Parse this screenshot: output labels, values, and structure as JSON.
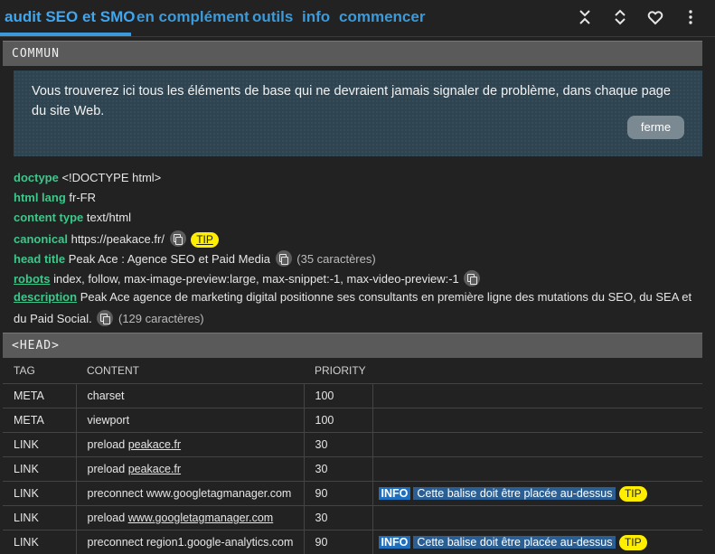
{
  "tabs": [
    "audit SEO et SMO",
    "en complément",
    "outils",
    "info",
    "commencer"
  ],
  "toolbar_icons": [
    "collapse-all-icon",
    "expand-all-icon",
    "heart-icon",
    "more-vertical-icon"
  ],
  "sections": {
    "commun": "COMMUN",
    "head": "<HEAD>"
  },
  "notice": {
    "text": "Vous trouverez ici tous les éléments de base qui ne devraient jamais signaler de problème, dans chaque page du site Web.",
    "close_label": "ferme"
  },
  "meta": {
    "doctype": {
      "key": "doctype",
      "value": "<!DOCTYPE html>"
    },
    "html_lang": {
      "key": "html lang",
      "value": "fr-FR"
    },
    "content_type": {
      "key": "content type",
      "value": "text/html"
    },
    "canonical": {
      "key": "canonical",
      "value": "https://peakace.fr/",
      "tip": "TIP"
    },
    "head_title": {
      "key": "head title",
      "value": "Peak Ace : Agence SEO et Paid Media",
      "count": "(35 caractères)"
    },
    "robots": {
      "key": "robots",
      "value": "index, follow, max-image-preview:large, max-snippet:-1, max-video-preview:-1"
    },
    "description": {
      "key": "description",
      "value_line1": "Peak Ace agence de marketing digital positionne ses consultants en première ligne des mutations du SEO, du SEA et",
      "value_line2": "du Paid Social.",
      "count": "(129 caractères)"
    }
  },
  "head_table": {
    "columns": [
      "TAG",
      "CONTENT",
      "PRIORITY"
    ],
    "rows": [
      {
        "tag": "META",
        "content": "charset",
        "priority": "100"
      },
      {
        "tag": "META",
        "content": "viewport",
        "priority": "100"
      },
      {
        "tag": "LINK",
        "content_prefix": "preload",
        "content_link": "peakace.fr",
        "priority": "30"
      },
      {
        "tag": "LINK",
        "content_prefix": "preload",
        "content_link": "peakace.fr",
        "priority": "30"
      },
      {
        "tag": "LINK",
        "content": "preconnect www.googletagmanager.com",
        "priority": "90",
        "info": "INFO",
        "info_text": "Cette balise doit être placée au-dessus",
        "tip": "TIP"
      },
      {
        "tag": "LINK",
        "content_prefix": "preload",
        "content_link": "www.googletagmanager.com",
        "priority": "30"
      },
      {
        "tag": "LINK",
        "content": "preconnect region1.google-analytics.com",
        "priority": "90",
        "info": "INFO",
        "info_text": "Cette balise doit être placée au-dessus",
        "tip": "TIP"
      }
    ]
  }
}
